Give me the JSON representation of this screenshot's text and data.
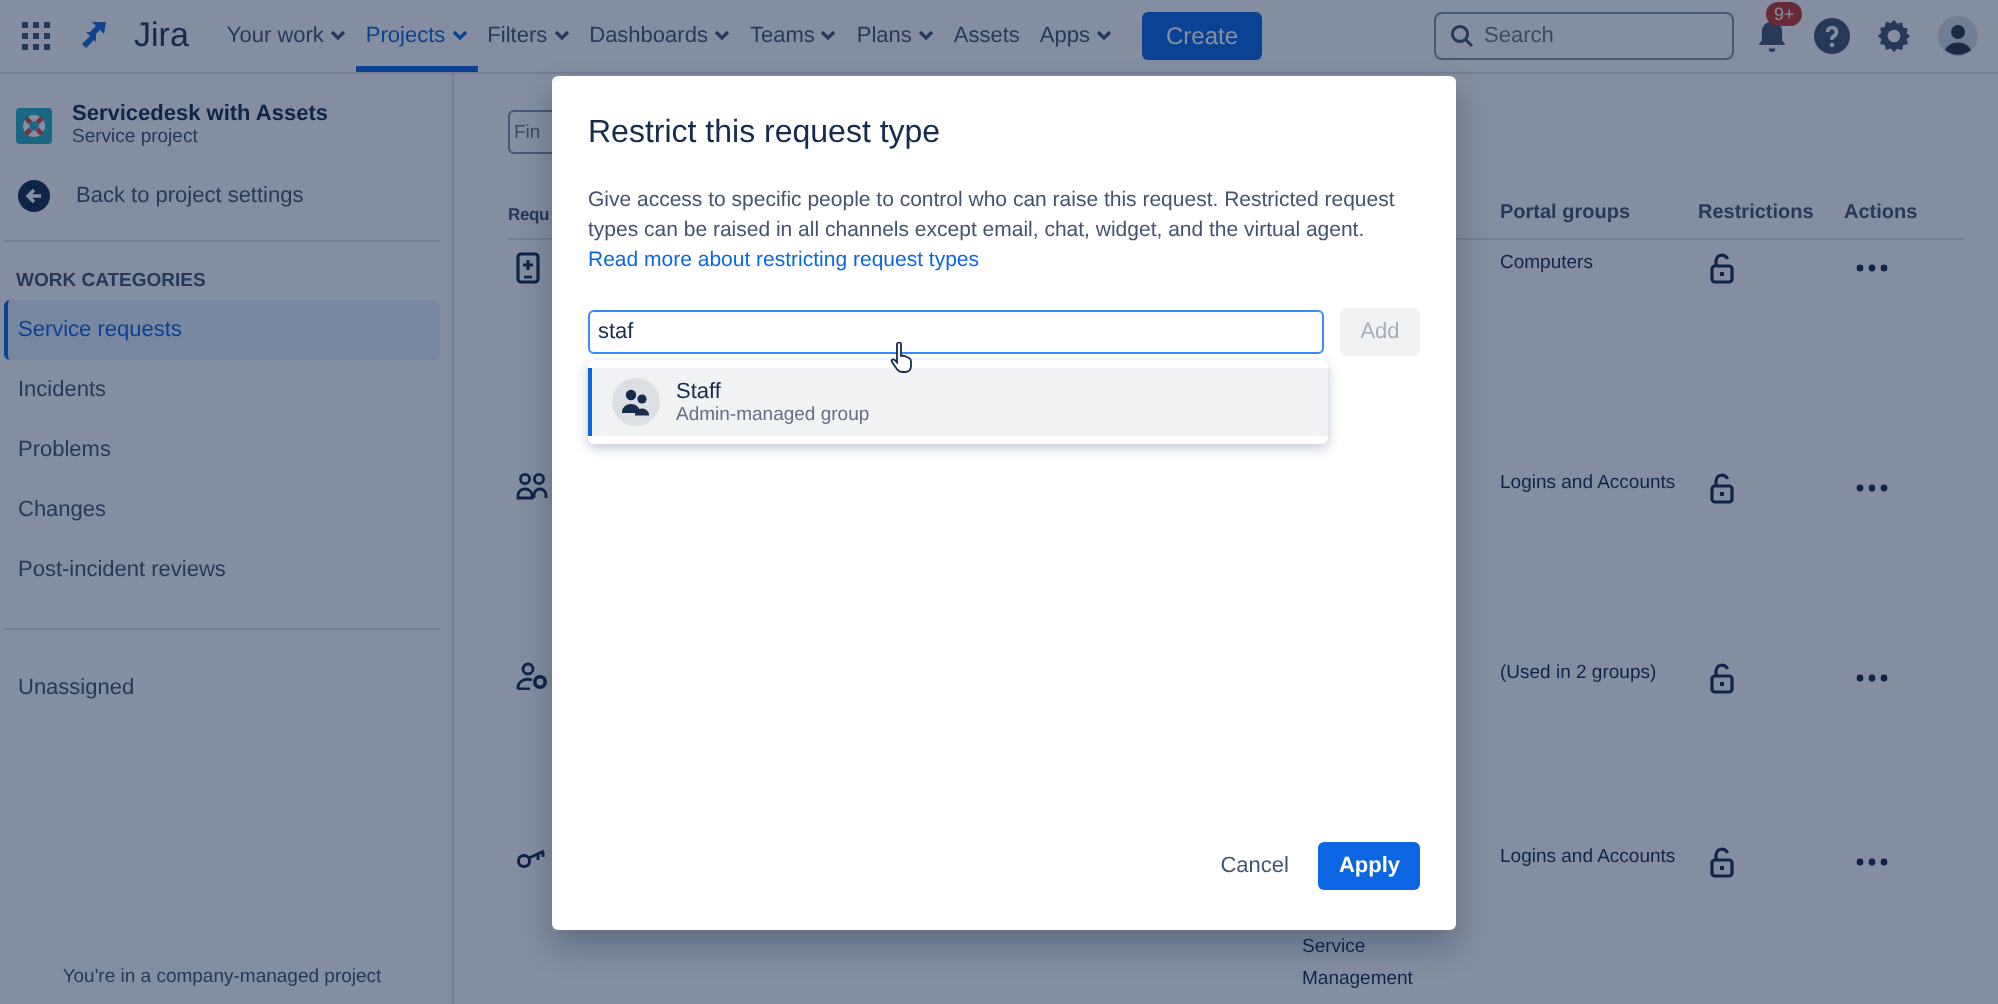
{
  "topbar": {
    "product": "Jira",
    "nav": [
      {
        "label": "Your work",
        "dropdown": true,
        "selected": false
      },
      {
        "label": "Projects",
        "dropdown": true,
        "selected": true
      },
      {
        "label": "Filters",
        "dropdown": true,
        "selected": false
      },
      {
        "label": "Dashboards",
        "dropdown": true,
        "selected": false
      },
      {
        "label": "Teams",
        "dropdown": true,
        "selected": false
      },
      {
        "label": "Plans",
        "dropdown": true,
        "selected": false
      },
      {
        "label": "Assets",
        "dropdown": false,
        "selected": false
      },
      {
        "label": "Apps",
        "dropdown": true,
        "selected": false
      }
    ],
    "create": "Create",
    "search": {
      "placeholder": "Search"
    },
    "notifications_badge": "9+"
  },
  "sidebar": {
    "project": {
      "name": "Servicedesk with Assets",
      "type": "Service project"
    },
    "back": "Back to project settings",
    "section": "WORK CATEGORIES",
    "items": [
      {
        "label": "Service requests",
        "selected": true
      },
      {
        "label": "Incidents",
        "selected": false
      },
      {
        "label": "Problems",
        "selected": false
      },
      {
        "label": "Changes",
        "selected": false
      },
      {
        "label": "Post-incident reviews",
        "selected": false
      }
    ],
    "other_items": [
      {
        "label": "Unassigned",
        "selected": false
      }
    ],
    "footer": "You're in a company-managed project"
  },
  "main": {
    "find": {
      "placeholder": "Fin"
    },
    "columns": [
      "Requ",
      "Portal groups",
      "Restrictions",
      "Actions"
    ],
    "rows": [
      {
        "kind": "phone",
        "portal_groups": "Computers",
        "restricted": false
      },
      {
        "kind": "people",
        "portal_groups": "Logins and Accounts",
        "restricted": false
      },
      {
        "kind": "person-gear",
        "portal_groups": "(Used in 2 groups)",
        "restricted": false
      },
      {
        "kind": "key",
        "description": "Service Management",
        "portal_groups": "Logins and Accounts",
        "restricted": false
      }
    ]
  },
  "modal": {
    "title": "Restrict this request type",
    "description": "Give access to specific people to control who can raise this request. Restricted request types can be raised in all channels except email, chat, widget, and the virtual agent.",
    "link": "Read more about restricting request types",
    "input": {
      "value": "staf"
    },
    "add": {
      "label": "Add",
      "disabled": true
    },
    "options": [
      {
        "name": "Staff",
        "subtitle": "Admin-managed group",
        "selected": true
      }
    ],
    "cancel": "Cancel",
    "apply": "Apply"
  }
}
